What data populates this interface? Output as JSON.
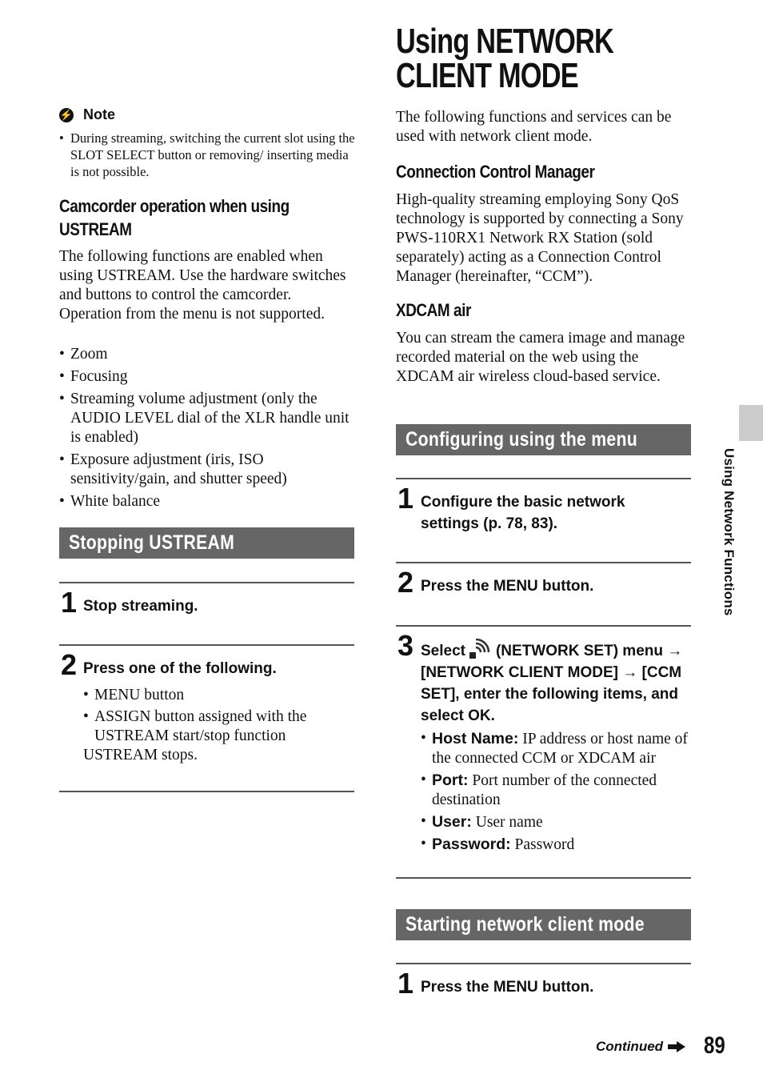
{
  "left_column": {
    "note": {
      "icon": "note-icon",
      "title": "Note",
      "items": [
        "During streaming, switching the current slot using the SLOT SELECT button or removing/ inserting media is not possible."
      ]
    },
    "camcorder_section": {
      "heading_line1": "Camcorder operation when using",
      "heading_line2": "USTREAM",
      "paragraph": "The following functions are enabled when using USTREAM. Use the hardware switches and buttons to control the camcorder. Operation from the menu is not supported.",
      "bullets": [
        "Zoom",
        "Focusing",
        "Streaming volume adjustment (only the AUDIO LEVEL dial of the XLR handle unit is enabled)",
        "Exposure adjustment (iris, ISO sensitivity/gain, and shutter speed)",
        "White balance"
      ]
    },
    "stopping_section": {
      "title": "Stopping USTREAM",
      "steps": [
        {
          "number": "1",
          "text": "Stop streaming."
        },
        {
          "number": "2",
          "text": "Press one of the following.",
          "bullets": [
            "MENU button",
            "ASSIGN button assigned with the USTREAM start/stop function"
          ],
          "result": "USTREAM stops."
        }
      ]
    }
  },
  "right_column": {
    "title_line1": "Using NETWORK",
    "title_line2": "CLIENT MODE",
    "intro": "The following functions and services can be used with network client mode.",
    "ccm": {
      "heading": "Connection Control Manager",
      "paragraph": "High-quality streaming employing Sony QoS technology is supported by connecting a Sony PWS-110RX1 Network RX Station (sold separately) acting as a Connection Control Manager (hereinafter, “CCM”)."
    },
    "xdcam": {
      "heading": "XDCAM air",
      "paragraph": "You can stream the camera image and manage recorded material on the web using the XDCAM air wireless cloud-based service."
    },
    "configuring_section": {
      "title": "Configuring using the menu",
      "steps": [
        {
          "number": "1",
          "text": "Configure the basic network settings (p. 78, 83)."
        },
        {
          "number": "2",
          "text": "Press the MENU button."
        },
        {
          "number": "3",
          "text_before_icon": "Select",
          "icon": "network-set-icon",
          "text_after_icon": "(NETWORK SET) menu → [NETWORK CLIENT MODE] → [CCM SET], enter the following items, and select OK.",
          "fields": [
            {
              "label": "Host Name:",
              "desc": "IP address or host name of the connected CCM or XDCAM air"
            },
            {
              "label": "Port:",
              "desc": "Port number of the connected destination"
            },
            {
              "label": "User:",
              "desc": "User name"
            },
            {
              "label": "Password:",
              "desc": "Password"
            }
          ]
        }
      ]
    },
    "starting_section": {
      "title": "Starting network client mode",
      "steps": [
        {
          "number": "1",
          "text": "Press the MENU button."
        }
      ]
    }
  },
  "side_tab": {
    "label": "Using Network Functions",
    "color": "#cccccc"
  },
  "footer": {
    "continued": "Continued",
    "page_number": "89"
  },
  "colors": {
    "section_bar": "#666666",
    "rule": "#555555",
    "text": "#111111"
  }
}
